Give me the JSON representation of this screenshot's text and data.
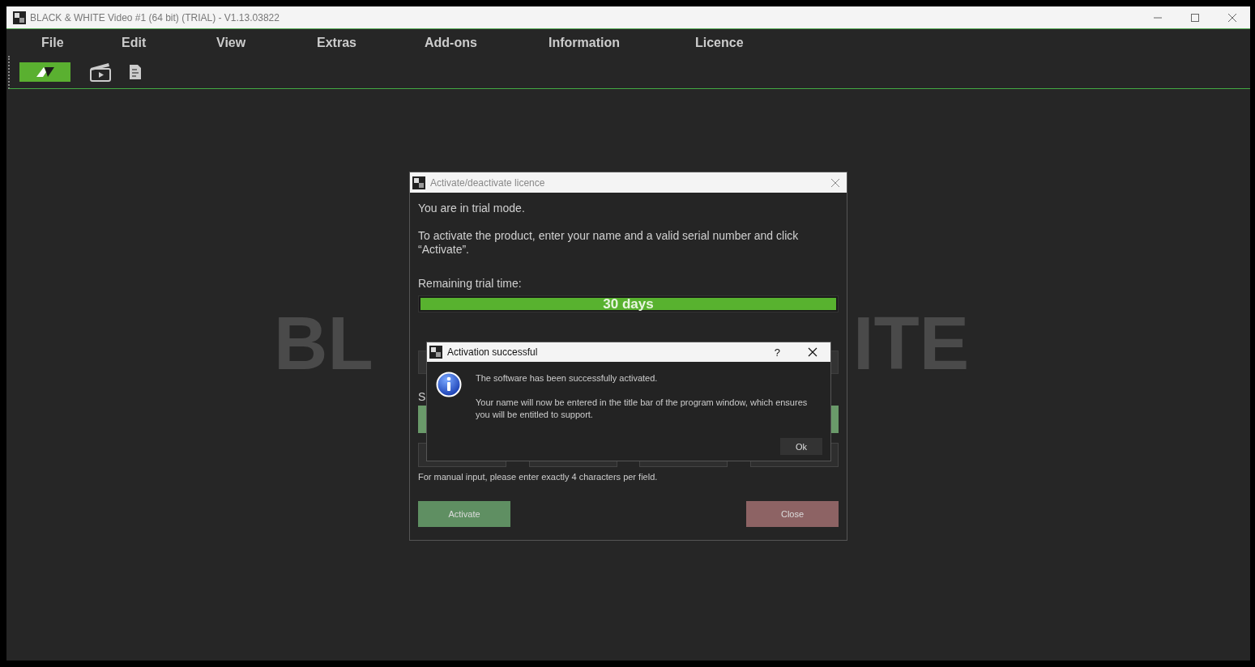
{
  "window": {
    "title": "BLACK & WHITE Video #1 (64 bit) (TRIAL) - V1.13.03822"
  },
  "menu": [
    "File",
    "Edit",
    "View",
    "Extras",
    "Add-ons",
    "Information",
    "Licence"
  ],
  "background_logo": [
    "BL",
    "ITE"
  ],
  "licence_dialog": {
    "title": "Activate/deactivate licence",
    "intro": "You are in trial mode.",
    "instructions": "To activate the product, enter your name and a valid serial number and click “Activate”.",
    "trial_label": "Remaining trial time:",
    "trial": {
      "level": 1,
      "reading": "30 days"
    },
    "serial_label": "S",
    "note": "For manual input, please enter exactly 4 characters per field.",
    "activate": "Activate",
    "close": "Close"
  },
  "message_box": {
    "title": "Activation successful",
    "help": "?",
    "message": "The software has been successfully activated.",
    "detail": "Your name will now be entered in the title bar of the program window, which ensures you will be entitled to support.",
    "ok": "Ok"
  }
}
